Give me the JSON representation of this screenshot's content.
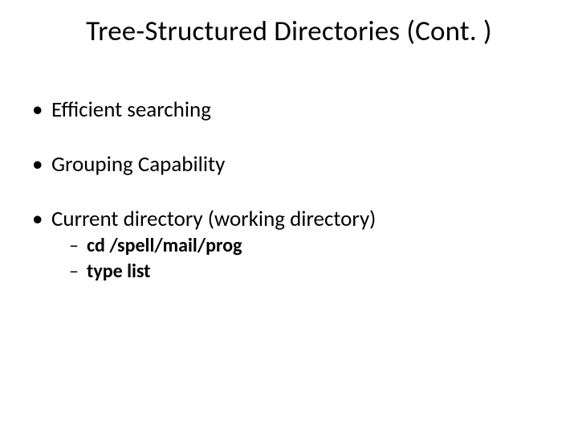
{
  "title": "Tree-Structured Directories (Cont. )",
  "bullets": {
    "b1": "Efficient searching",
    "b2": "Grouping Capability",
    "b3": "Current directory (working directory)",
    "b3_sub1": "cd /spell/mail/prog",
    "b3_sub2": "type list"
  }
}
